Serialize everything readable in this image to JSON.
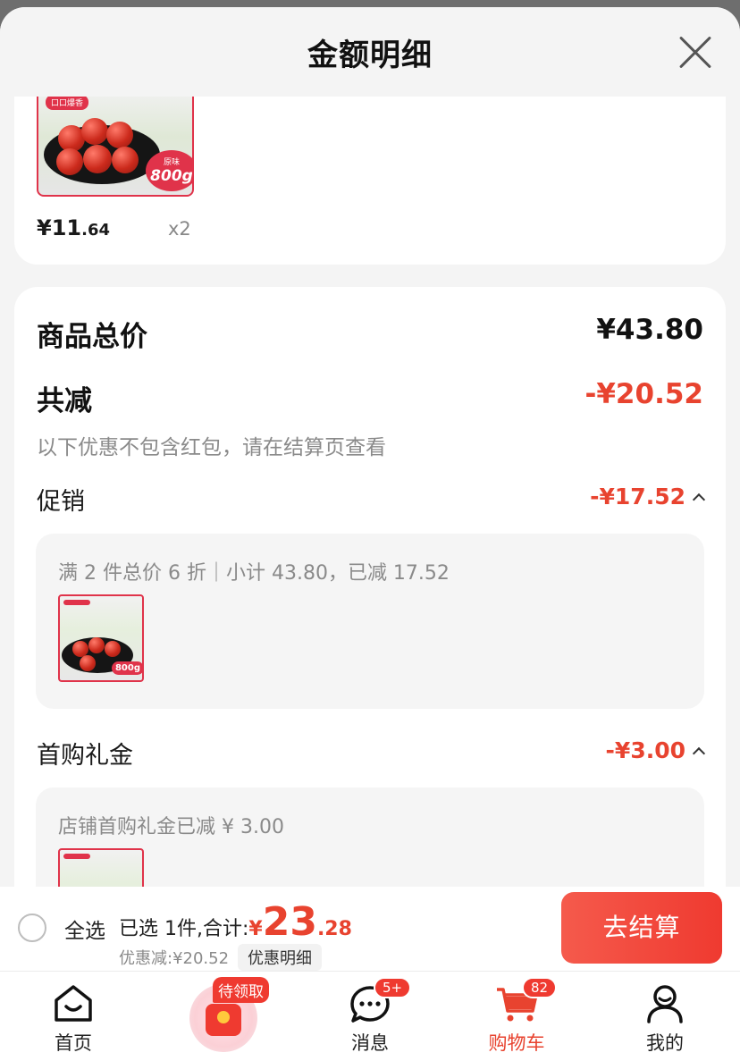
{
  "sheet": {
    "title": "金额明细"
  },
  "product": {
    "thumb_tag": "口口爆香",
    "thumb_badge_small": "原味",
    "thumb_badge_big": "800g",
    "price_yen": "¥11",
    "price_decimal": ".64",
    "quantity": "x2"
  },
  "summary": {
    "total_label": "商品总价",
    "total_value": "¥43.80",
    "reduce_label": "共减",
    "reduce_value": "-¥20.52",
    "note": "以下优惠不包含红包，请在结算页查看"
  },
  "promotion": {
    "label": "促销",
    "value": "-¥17.52",
    "detail": "满 2 件总价 6 折｜小计 43.80，已减 17.52",
    "thumb_badge": "800g"
  },
  "first_purchase": {
    "label": "首购礼金",
    "value": "-¥3.00",
    "detail": "店铺首购礼金已减 ¥ 3.00"
  },
  "checkout": {
    "select_all": "全选",
    "selected_text": "已选 1件,合计:",
    "total_yen": "¥",
    "total_int": "23",
    "total_dec": ".28",
    "discount_text": "优惠减:¥20.52",
    "discount_detail_btn": "优惠明细",
    "pay_btn": "去结算"
  },
  "tabbar": {
    "home": "首页",
    "promo_badge": "待领取",
    "messages": "消息",
    "messages_badge": "5+",
    "cart": "购物车",
    "cart_badge": "82",
    "mine": "我的"
  },
  "colors": {
    "accent": "#e8432f",
    "badge": "#ef3a30"
  }
}
